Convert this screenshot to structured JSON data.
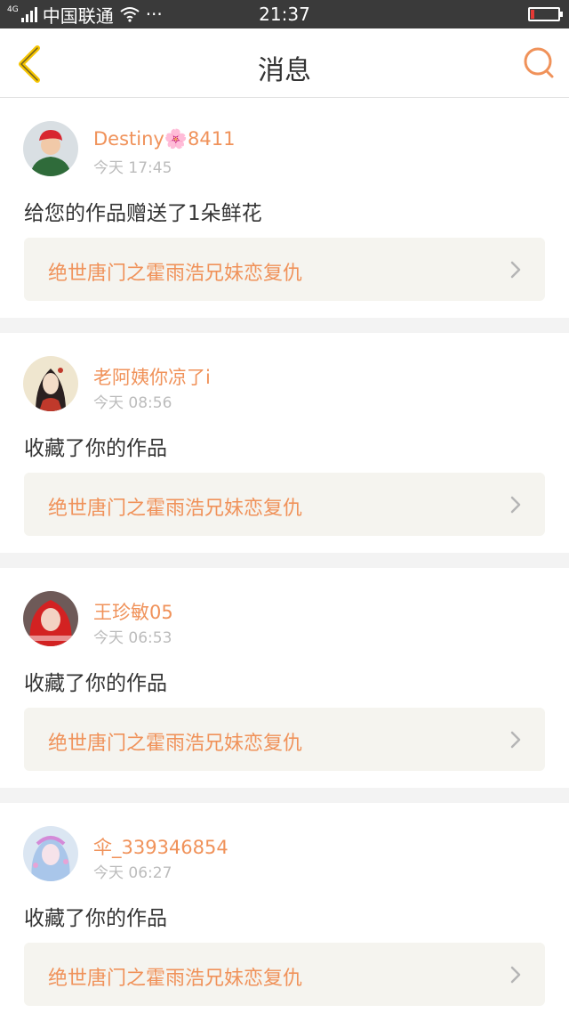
{
  "status_bar": {
    "carrier": "中国联通",
    "network": "4G",
    "dots": "···",
    "time": "21:37"
  },
  "nav": {
    "title": "消息",
    "back_icon": "back-chevron-icon",
    "search_icon": "search-icon"
  },
  "colors": {
    "accent": "#f0925a",
    "nav_back": "#f5c400",
    "work_bg": "#f5f4ef",
    "meta": "#bcbcbc"
  },
  "messages": [
    {
      "user": "Destiny🌸8411",
      "time": "今天 17:45",
      "action": "给您的作品赠送了1朵鲜花",
      "work": "绝世唐门之霍雨浩兄妹恋复仇"
    },
    {
      "user": "老阿姨你凉了i",
      "time": "今天 08:56",
      "action": "收藏了你的作品",
      "work": "绝世唐门之霍雨浩兄妹恋复仇"
    },
    {
      "user": "王珍敏05",
      "time": "今天 06:53",
      "action": "收藏了你的作品",
      "work": "绝世唐门之霍雨浩兄妹恋复仇"
    },
    {
      "user": "伞_339346854",
      "time": "今天 06:27",
      "action": "收藏了你的作品",
      "work": "绝世唐门之霍雨浩兄妹恋复仇"
    }
  ]
}
